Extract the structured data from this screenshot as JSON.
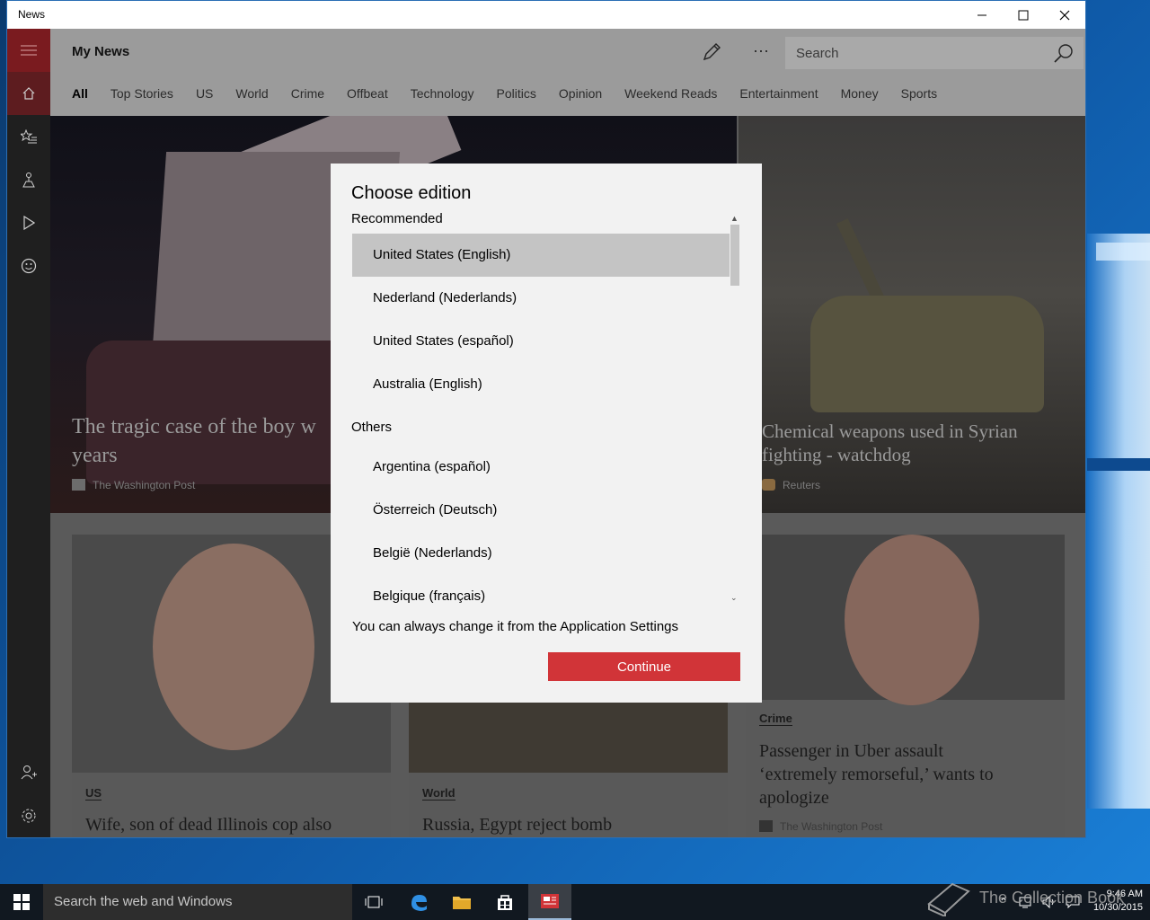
{
  "window": {
    "title": "News"
  },
  "header": {
    "title": "My News",
    "search_placeholder": "Search",
    "more_label": "···"
  },
  "tabs": [
    "All",
    "Top Stories",
    "US",
    "World",
    "Crime",
    "Offbeat",
    "Technology",
    "Politics",
    "Opinion",
    "Weekend Reads",
    "Entertainment",
    "Money",
    "Sports"
  ],
  "hero": [
    {
      "headline": "The tragic case of the boy w… years",
      "line1": "The tragic case of the boy w",
      "line2": "years",
      "source": "The Washington Post"
    },
    {
      "line1": "Chemical weapons used in Syrian",
      "line2": "fighting - watchdog",
      "source": "Reuters"
    }
  ],
  "cards": [
    {
      "category": "US",
      "headline": "Wife, son of dead Illinois cop also"
    },
    {
      "category": "World",
      "headline": "Russia, Egypt reject bomb"
    },
    {
      "category": "Crime",
      "line1": "Passenger in Uber assault",
      "line2": "‘extremely remorseful,’ wants to",
      "line3": "apologize",
      "source": "The Washington Post"
    }
  ],
  "dialog": {
    "title": "Choose edition",
    "recommended_header": "Recommended",
    "recommended": [
      "United States (English)",
      "Nederland (Nederlands)",
      "United States (español)",
      "Australia (English)"
    ],
    "others_header": "Others",
    "others": [
      "Argentina (español)",
      "Österreich (Deutsch)",
      "België (Nederlands)",
      "Belgique (français)"
    ],
    "selected": "United States (English)",
    "note": "You can always change it from the Application Settings",
    "continue_label": "Continue"
  },
  "taskbar": {
    "search_placeholder": "Search the web and Windows",
    "time": "9:46 AM",
    "date": "10/30/2015"
  },
  "watermark": "The Collection Book",
  "colors": {
    "accent": "#d13438",
    "sidebar_active": "#5d1c1f",
    "selected_item": "#c4c4c4"
  }
}
